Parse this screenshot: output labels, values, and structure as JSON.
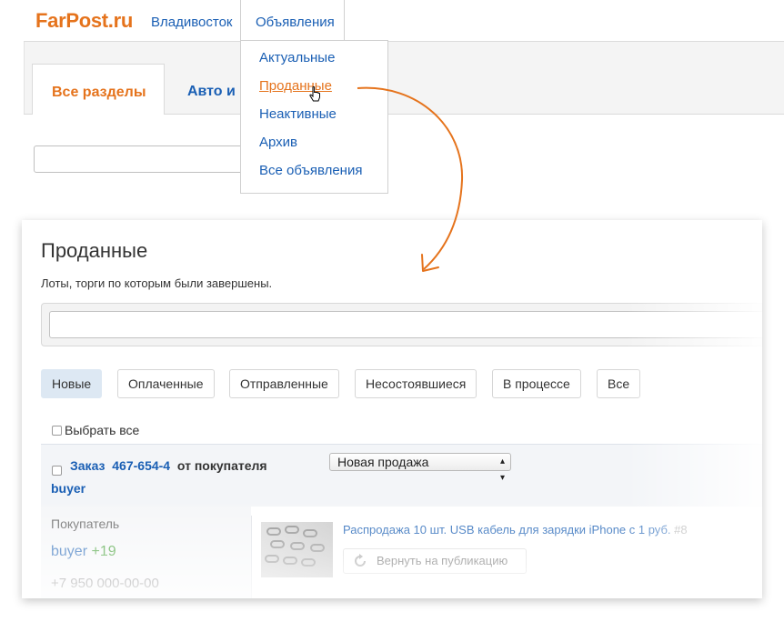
{
  "header": {
    "logo": "FarPost.ru",
    "city": "Владивосток",
    "ads_tab": "Объявления"
  },
  "tabs": {
    "all": "Все разделы",
    "auto": "Авто и"
  },
  "dropdown": {
    "items": [
      "Актуальные",
      "Проданные",
      "Неактивные",
      "Архив",
      "Все объявления"
    ],
    "active_index": 1
  },
  "page": {
    "title": "Проданные",
    "subtitle": "Лоты, торги по которым были завершены."
  },
  "filters": [
    "Новые",
    "Оплаченные",
    "Отправленные",
    "Несостоявшиеся",
    "В процессе",
    "Все"
  ],
  "select_all": "Выбрать все",
  "order": {
    "prefix": "Заказ",
    "number": "467-654-4",
    "from": "от покупателя",
    "buyer": "buyer",
    "status": "Новая продажа",
    "buyer_label": "Покупатель",
    "buyer_name": "buyer",
    "buyer_rating": "+19",
    "buyer_phone": "+7 950 000-00-00",
    "item_title": "Распродажа 10 шт. USB кабель для зарядки iPhone с 1 руб.",
    "item_number": "#8",
    "republish": "Вернуть на публикацию"
  },
  "colors": {
    "brand_orange": "#e5731c",
    "link_blue": "#1a5fb4",
    "active_filter": "#dde8f3",
    "rating_green": "#3a9a2b"
  },
  "icons": {
    "cursor": "hand-pointer-icon",
    "arrow": "curved-arrow-icon",
    "republish": "refresh-icon"
  }
}
